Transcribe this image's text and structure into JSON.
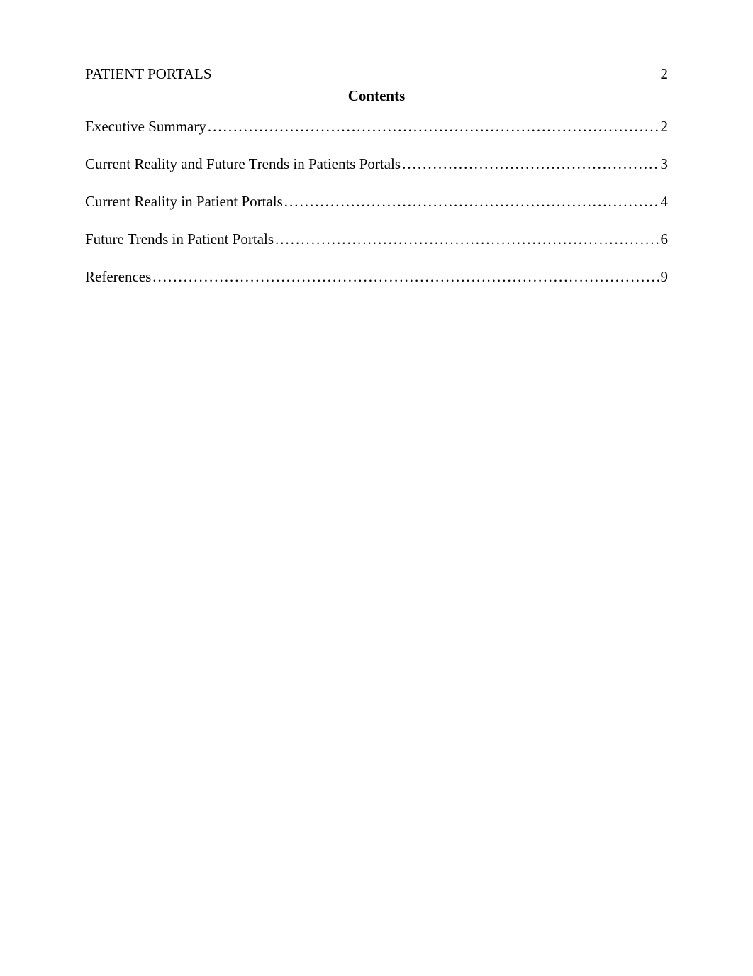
{
  "header": {
    "running_title": "PATIENT PORTALS",
    "page_number": "2"
  },
  "contents_heading": "Contents",
  "toc": [
    {
      "title": "Executive Summary",
      "page": "2"
    },
    {
      "title": "Current Reality and Future Trends in Patients Portals",
      "page": "3"
    },
    {
      "title": "Current Reality in Patient Portals",
      "page": "4"
    },
    {
      "title": "Future Trends in Patient Portals",
      "page": "6"
    },
    {
      "title": "References",
      "page": "9"
    }
  ],
  "dots": "........................................................................................................................................................................................................................"
}
